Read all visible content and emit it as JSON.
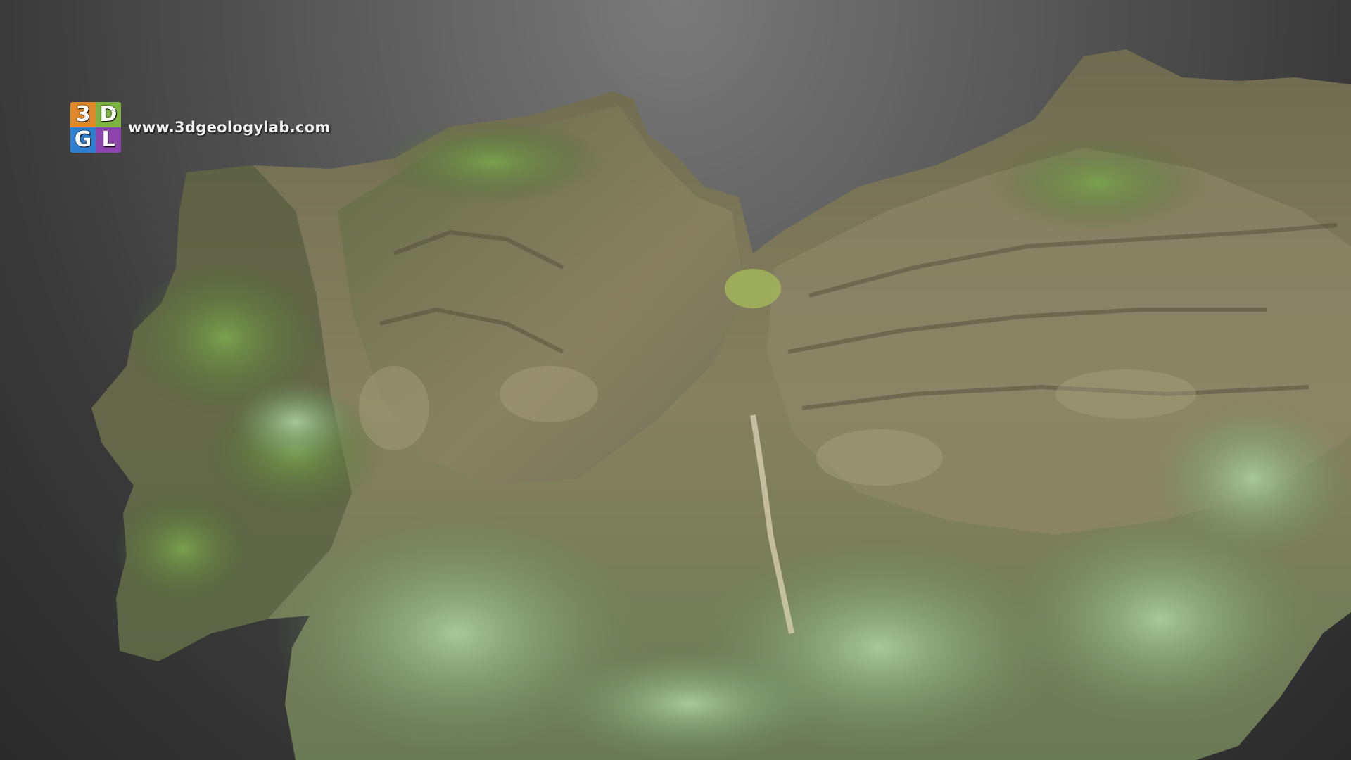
{
  "viewer": {
    "background_top": "#7a7a7a",
    "background_bottom": "#2a2a2a"
  },
  "watermark": {
    "logo_letters": [
      "3",
      "D",
      "G",
      "L"
    ],
    "logo_colors": [
      "#e0892a",
      "#7cb342",
      "#2f7fd1",
      "#8e44ad"
    ],
    "url": "www.3dgeologylab.com"
  },
  "model": {
    "rock_color": "#7d7a5c",
    "moss_color": "#5e7a3a",
    "leaf_color": "#8fb07a"
  }
}
